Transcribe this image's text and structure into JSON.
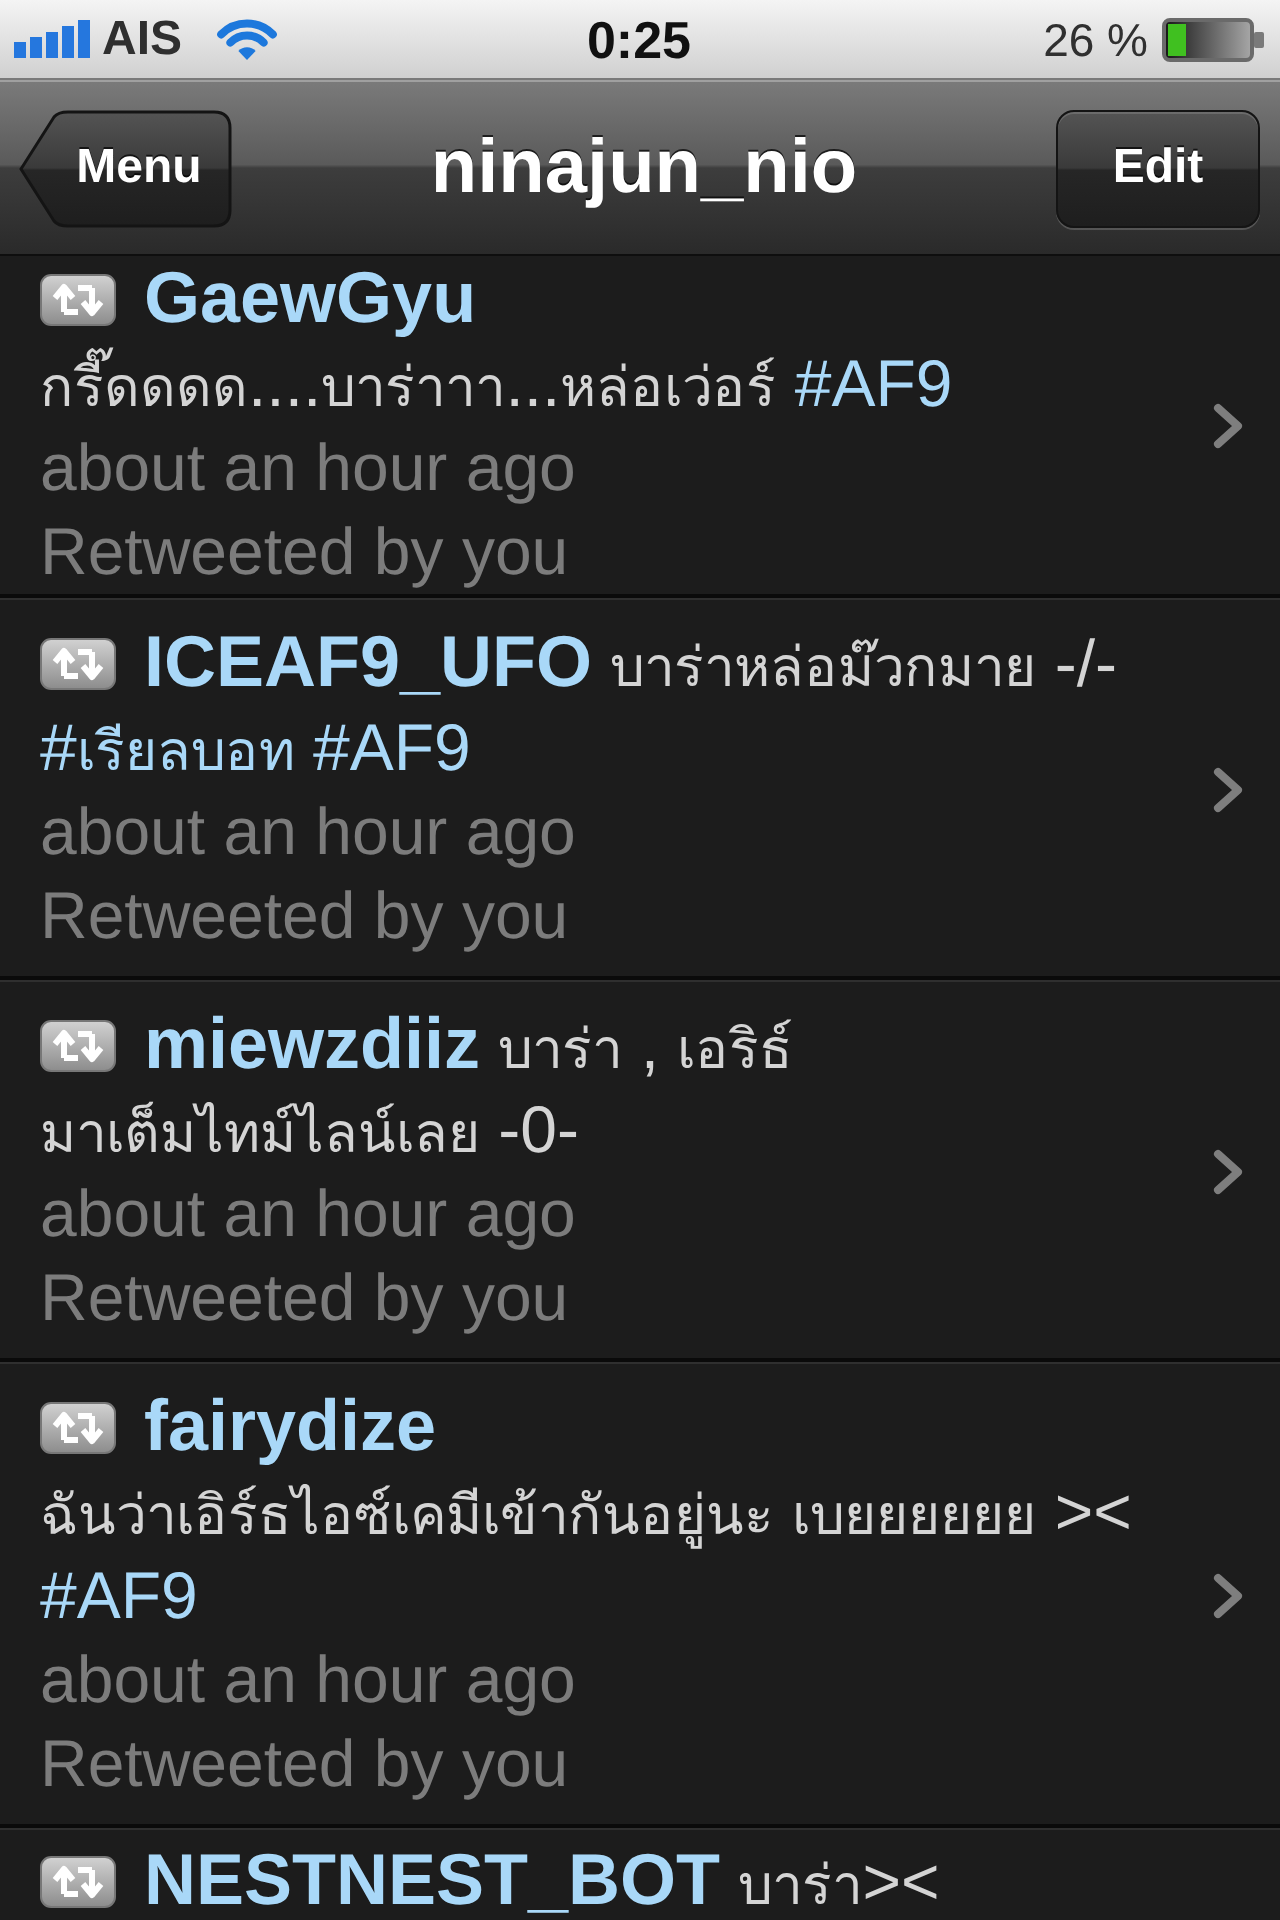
{
  "status_bar": {
    "carrier": "AIS",
    "time": "0:25",
    "battery_percent": "26 %"
  },
  "nav_bar": {
    "back_button": "Menu",
    "title": "ninajun_nio",
    "edit_button": "Edit"
  },
  "tweets": [
    {
      "user": "GaewGyu",
      "text": [
        {
          "kind": "plain",
          "text": "กรี๊ดดดด....บาร่าาา...หล่อเว่อร์"
        },
        {
          "kind": "hashtag",
          "text": "#AF9"
        }
      ],
      "time": "about an hour ago",
      "retweeted_by": "Retweeted by you"
    },
    {
      "user": "ICEAF9_UFO",
      "text": [
        {
          "kind": "plain",
          "text": "บาร่าหล่อม๊วกมาย -/-"
        },
        {
          "kind": "hashtag",
          "text": "#เรียลบอท"
        },
        {
          "kind": "hashtag",
          "text": "#AF9"
        }
      ],
      "time": "about an hour ago",
      "retweeted_by": "Retweeted by you"
    },
    {
      "user": "miewzdiiz",
      "text": [
        {
          "kind": "plain",
          "text": "บาร่า , เอริธ์ มาเต็มไทม์ไลน์เลย -0-"
        }
      ],
      "time": "about an hour ago",
      "retweeted_by": "Retweeted by you"
    },
    {
      "user": "fairydize",
      "text": [
        {
          "kind": "plain",
          "text": "ฉันว่าเอิร์ธไอซ์เคมีเข้ากันอยู่นะ เบยยยยยย ><"
        },
        {
          "kind": "hashtag",
          "text": "#AF9"
        }
      ],
      "time": "about an hour ago",
      "retweeted_by": "Retweeted by you"
    },
    {
      "user": "NESTNEST_BOT",
      "text": [
        {
          "kind": "plain",
          "text": "บาร่า><"
        }
      ]
    }
  ]
}
